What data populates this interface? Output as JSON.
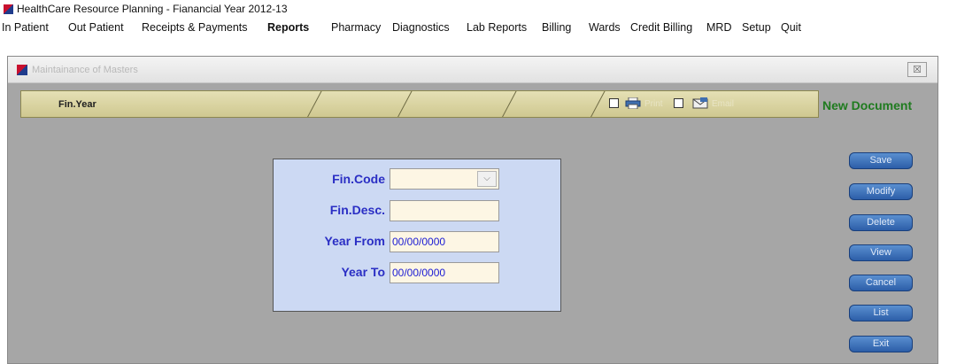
{
  "app": {
    "title": "HealthCare Resource Planning - Fianancial Year 2012-13"
  },
  "menu": {
    "items": [
      "In Patient",
      "Out Patient",
      "Receipts & Payments",
      "Reports",
      "Pharmacy",
      "Diagnostics",
      "Lab Reports",
      "Billing",
      "Wards",
      "Credit Billing",
      "MRD",
      "Setup",
      "Quit"
    ],
    "active": "Reports"
  },
  "window": {
    "title": "Maintainance of Masters",
    "close_glyph": "☒"
  },
  "tabstrip": {
    "tab_label": "Fin.Year",
    "print_label": "Print",
    "email_label": "Email"
  },
  "status": {
    "new_document": "New Document"
  },
  "buttons": [
    "Save",
    "Modify",
    "Delete",
    "View",
    "Cancel",
    "List",
    "Exit"
  ],
  "form": {
    "fin_code": {
      "label": "Fin.Code",
      "value": ""
    },
    "fin_desc": {
      "label": "Fin.Desc.",
      "value": ""
    },
    "year_from": {
      "label": "Year From",
      "value": "00/00/0000"
    },
    "year_to": {
      "label": "Year To",
      "value": "00/00/0000"
    }
  },
  "icons": [
    "app-logo-icon",
    "window-logo-icon",
    "printer-icon",
    "email-icon",
    "dropdown-chevron-icon",
    "close-icon"
  ],
  "colors": {
    "menu_text": "#111111",
    "new_document": "#1f7b1f",
    "label_blue": "#2a2ec4",
    "button_blue": "#2c5ea8",
    "panel_bg": "#ccd9f3",
    "window_bg": "#a6a6a6"
  }
}
